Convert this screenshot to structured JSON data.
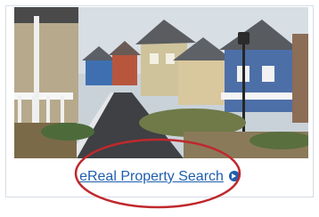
{
  "link": {
    "label": "eReal Property Search",
    "color": "#1f5fae"
  },
  "photo": {
    "subject": "residential-street-houses"
  },
  "annotation": {
    "color": "#c0282d"
  },
  "icons": {
    "link_arrow": "circle-arrow-right-icon"
  }
}
